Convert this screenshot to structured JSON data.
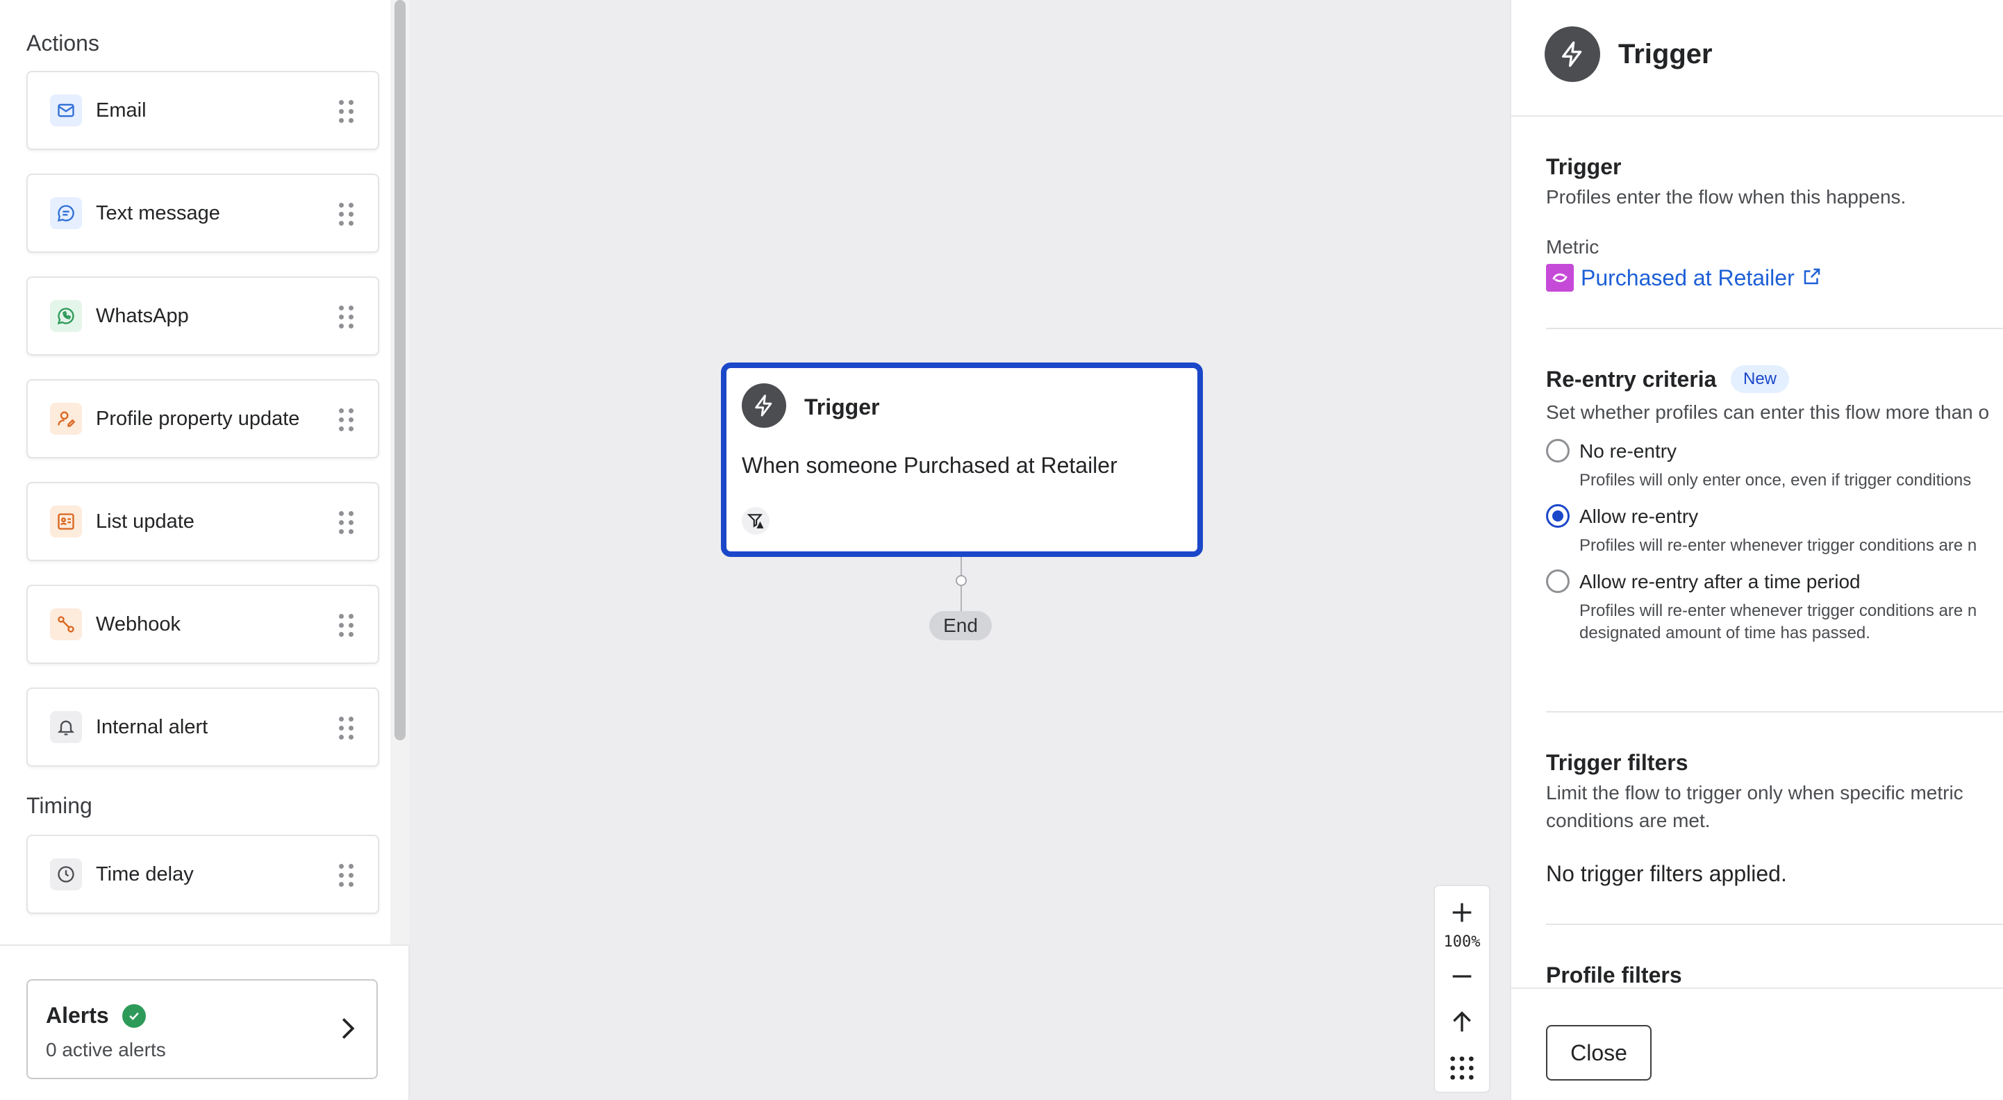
{
  "sidebar": {
    "actions_title": "Actions",
    "actions": [
      {
        "label": "Email",
        "icon": "email-icon",
        "color": "#2f6fd6",
        "bg": "#e6efff"
      },
      {
        "label": "Text message",
        "icon": "message-icon",
        "color": "#2f6fd6",
        "bg": "#e6efff"
      },
      {
        "label": "WhatsApp",
        "icon": "whatsapp-icon",
        "color": "#2e9a5a",
        "bg": "#e4f5ea"
      },
      {
        "label": "Profile property update",
        "icon": "profile-icon",
        "color": "#d9661f",
        "bg": "#fdebdc"
      },
      {
        "label": "List update",
        "icon": "list-icon",
        "color": "#d9661f",
        "bg": "#fdebdc"
      },
      {
        "label": "Webhook",
        "icon": "webhook-icon",
        "color": "#d9661f",
        "bg": "#fdebdc"
      },
      {
        "label": "Internal alert",
        "icon": "bell-icon",
        "color": "#4b4d51",
        "bg": "#eeeef0"
      }
    ],
    "timing_title": "Timing",
    "timing": [
      {
        "label": "Time delay",
        "icon": "clock-icon",
        "color": "#4b4d51",
        "bg": "#eeeef0"
      }
    ],
    "alerts": {
      "title": "Alerts",
      "subtitle": "0 active alerts"
    }
  },
  "canvas": {
    "node": {
      "title": "Trigger",
      "text": "When someone Purchased at Retailer"
    },
    "end_label": "End",
    "zoom_level": "100%"
  },
  "panel": {
    "title": "Trigger",
    "trigger_heading": "Trigger",
    "trigger_desc": "Profiles enter the flow when this happens.",
    "metric_label": "Metric",
    "metric_value": "Purchased at Retailer",
    "reentry_heading": "Re-entry criteria",
    "new_badge": "New",
    "reentry_desc": "Set whether profiles can enter this flow more than o",
    "options": [
      {
        "label": "No re-entry",
        "desc": [
          "Profiles will only enter once, even if trigger conditions"
        ],
        "checked": false
      },
      {
        "label": "Allow re-entry",
        "desc": [
          "Profiles will re-enter whenever trigger conditions are n"
        ],
        "checked": true
      },
      {
        "label": "Allow re-entry after a time period",
        "desc": [
          "Profiles will re-enter whenever trigger conditions are n",
          "designated amount of time has passed."
        ],
        "checked": false
      }
    ],
    "trigger_filters_heading": "Trigger filters",
    "trigger_filters_desc_1": "Limit the flow to trigger only when specific metric",
    "trigger_filters_desc_2": "conditions are met.",
    "trigger_filters_empty": "No trigger filters applied.",
    "profile_filters_heading": "Profile filters",
    "close_label": "Close"
  },
  "colors": {
    "accent": "#1b47c9",
    "link": "#1d5fd6",
    "success": "#2e9a5a"
  }
}
